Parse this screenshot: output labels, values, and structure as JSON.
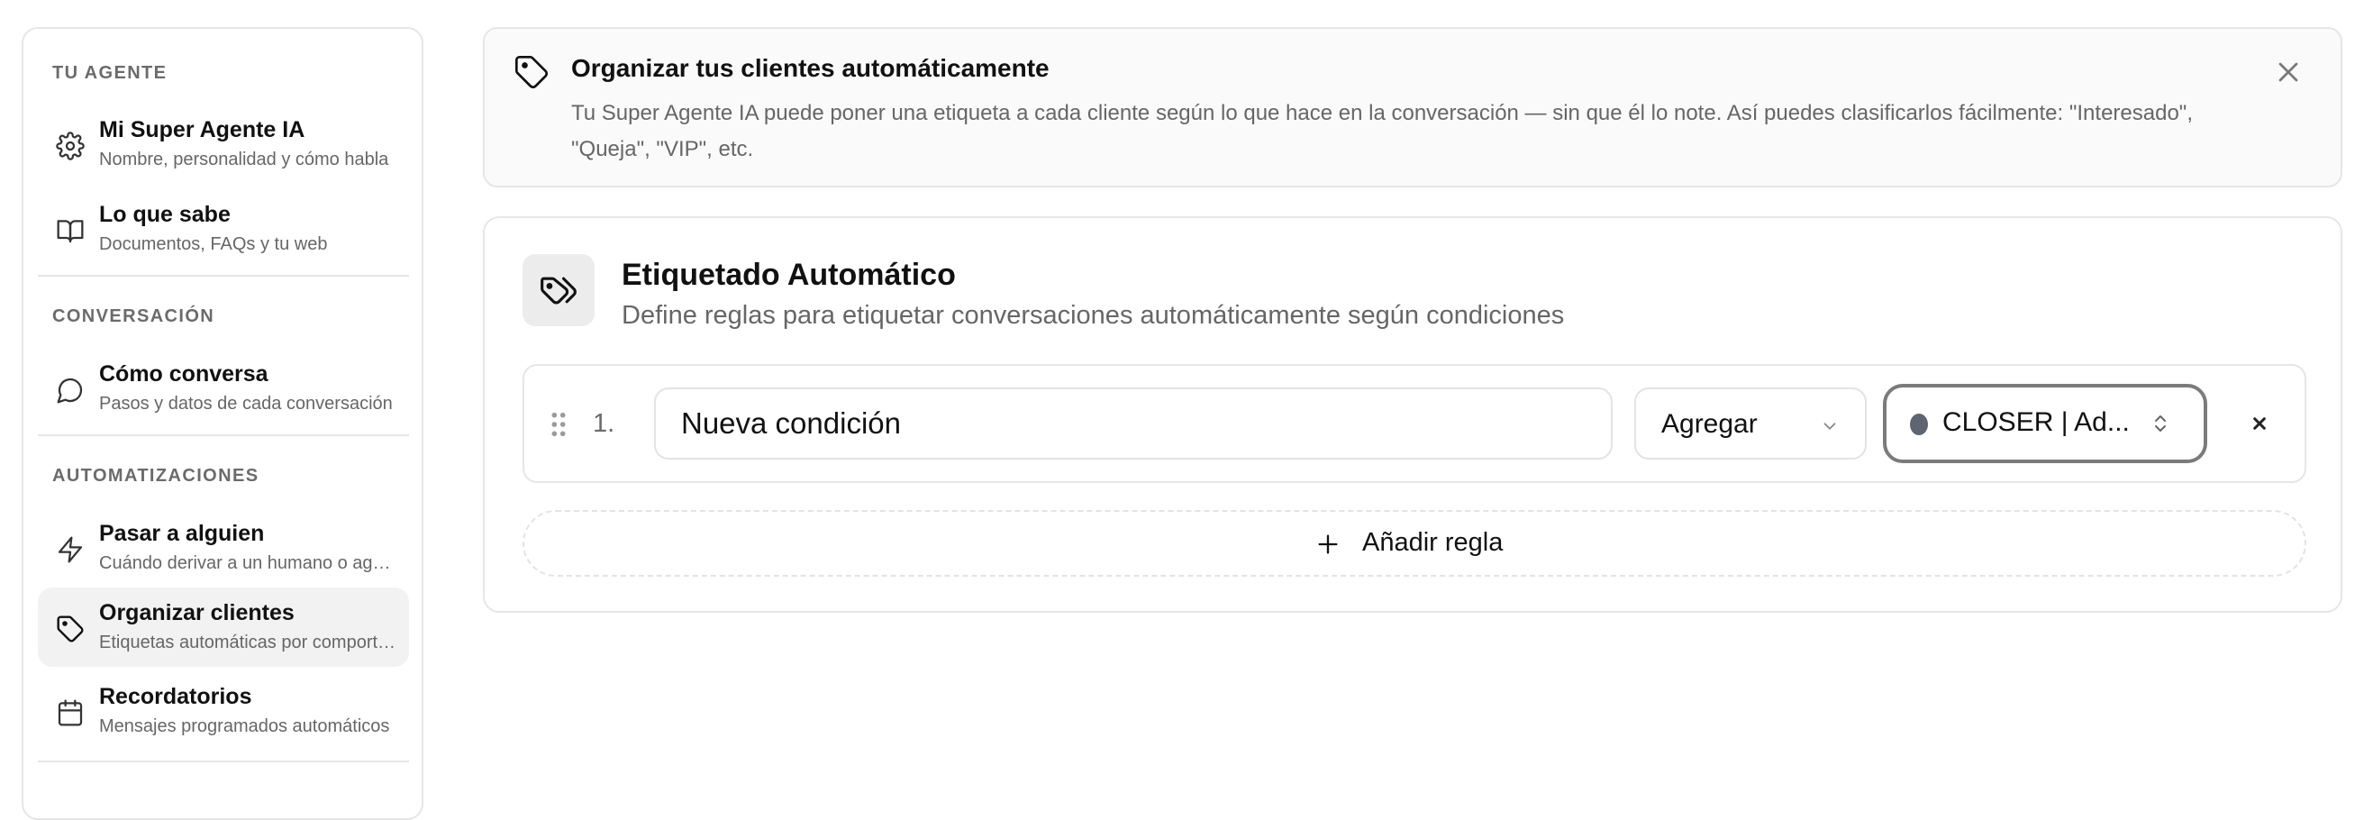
{
  "sidebar": {
    "sections": [
      {
        "label": "TU AGENTE",
        "items": [
          {
            "title": "Mi Super Agente IA",
            "subtitle": "Nombre, personalidad y cómo habla",
            "icon": "gear-icon"
          },
          {
            "title": "Lo que sabe",
            "subtitle": "Documentos, FAQs y tu web",
            "icon": "book-icon"
          }
        ]
      },
      {
        "label": "CONVERSACIÓN",
        "items": [
          {
            "title": "Cómo conversa",
            "subtitle": "Pasos y datos de cada conversación",
            "icon": "chat-bubble-icon"
          }
        ]
      },
      {
        "label": "AUTOMATIZACIONES",
        "items": [
          {
            "title": "Pasar a alguien",
            "subtitle": "Cuándo derivar a un humano o agente",
            "icon": "lightning-icon"
          },
          {
            "title": "Organizar clientes",
            "subtitle": "Etiquetas automáticas por comportamiento",
            "icon": "tag-icon",
            "active": true
          },
          {
            "title": "Recordatorios",
            "subtitle": "Mensajes programados automáticos",
            "icon": "calendar-icon"
          }
        ]
      }
    ]
  },
  "banner": {
    "title": "Organizar tus clientes automáticamente",
    "text": "Tu Super Agente IA puede poner una etiqueta a cada cliente según lo que hace en la conversación — sin que él lo note. Así puedes clasificarlos fácilmente: \"Interesado\", \"Queja\", \"VIP\", etc."
  },
  "card": {
    "title": "Etiquetado Automático",
    "subtitle": "Define reglas para etiquetar conversaciones automáticamente según condiciones",
    "rules": [
      {
        "number": "1.",
        "condition_value": "Nueva condición",
        "action": "Agregar",
        "tag": "CLOSER | Ad...",
        "tag_color": "#5e6472"
      }
    ],
    "add_rule_label": "Añadir regla"
  },
  "colors": {
    "border": "#e6e6e6",
    "active_item_bg": "#f2f2f2",
    "muted_text": "#666666",
    "focus_ring": "#7b7b7b"
  }
}
